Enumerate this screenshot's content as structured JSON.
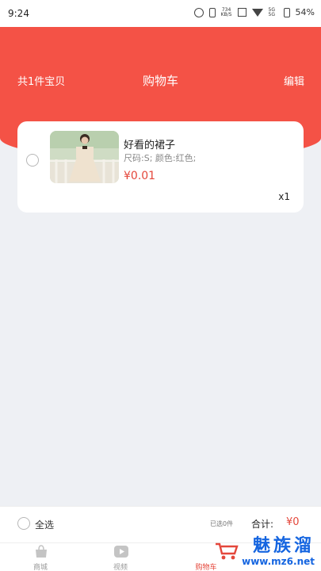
{
  "status_bar": {
    "time": "9:24",
    "speed_top": "734",
    "speed_bottom": "KB/S",
    "signal_label": "5G",
    "battery": "54%",
    "icons": [
      "alarm-icon",
      "vibrate-icon",
      "nfc-icon",
      "wifi-icon",
      "signal-icon",
      "battery-icon"
    ]
  },
  "header": {
    "count_label": "共1件宝贝",
    "title": "购物车",
    "edit_label": "编辑",
    "background_color": "#f45246"
  },
  "cart": {
    "items": [
      {
        "name": "好看的裙子",
        "spec": "尺码:S; 颜色:红色;",
        "price": "¥0.01",
        "quantity": "x1",
        "selected": false
      }
    ]
  },
  "checkout": {
    "select_all_label": "全选",
    "selected_count": "已选0件",
    "total_label": "合计:",
    "total_value": "¥0"
  },
  "tabs": [
    {
      "label": "商城",
      "icon": "bag-icon",
      "active": false
    },
    {
      "label": "视频",
      "icon": "play-icon",
      "active": false
    },
    {
      "label": "购物车",
      "icon": "cart-icon",
      "active": true
    }
  ],
  "watermark": {
    "main": "魅族溜",
    "url": "www.mz6.net"
  },
  "colors": {
    "accent": "#e4473b",
    "page_background": "#eef0f4",
    "watermark": "#1565e0"
  }
}
